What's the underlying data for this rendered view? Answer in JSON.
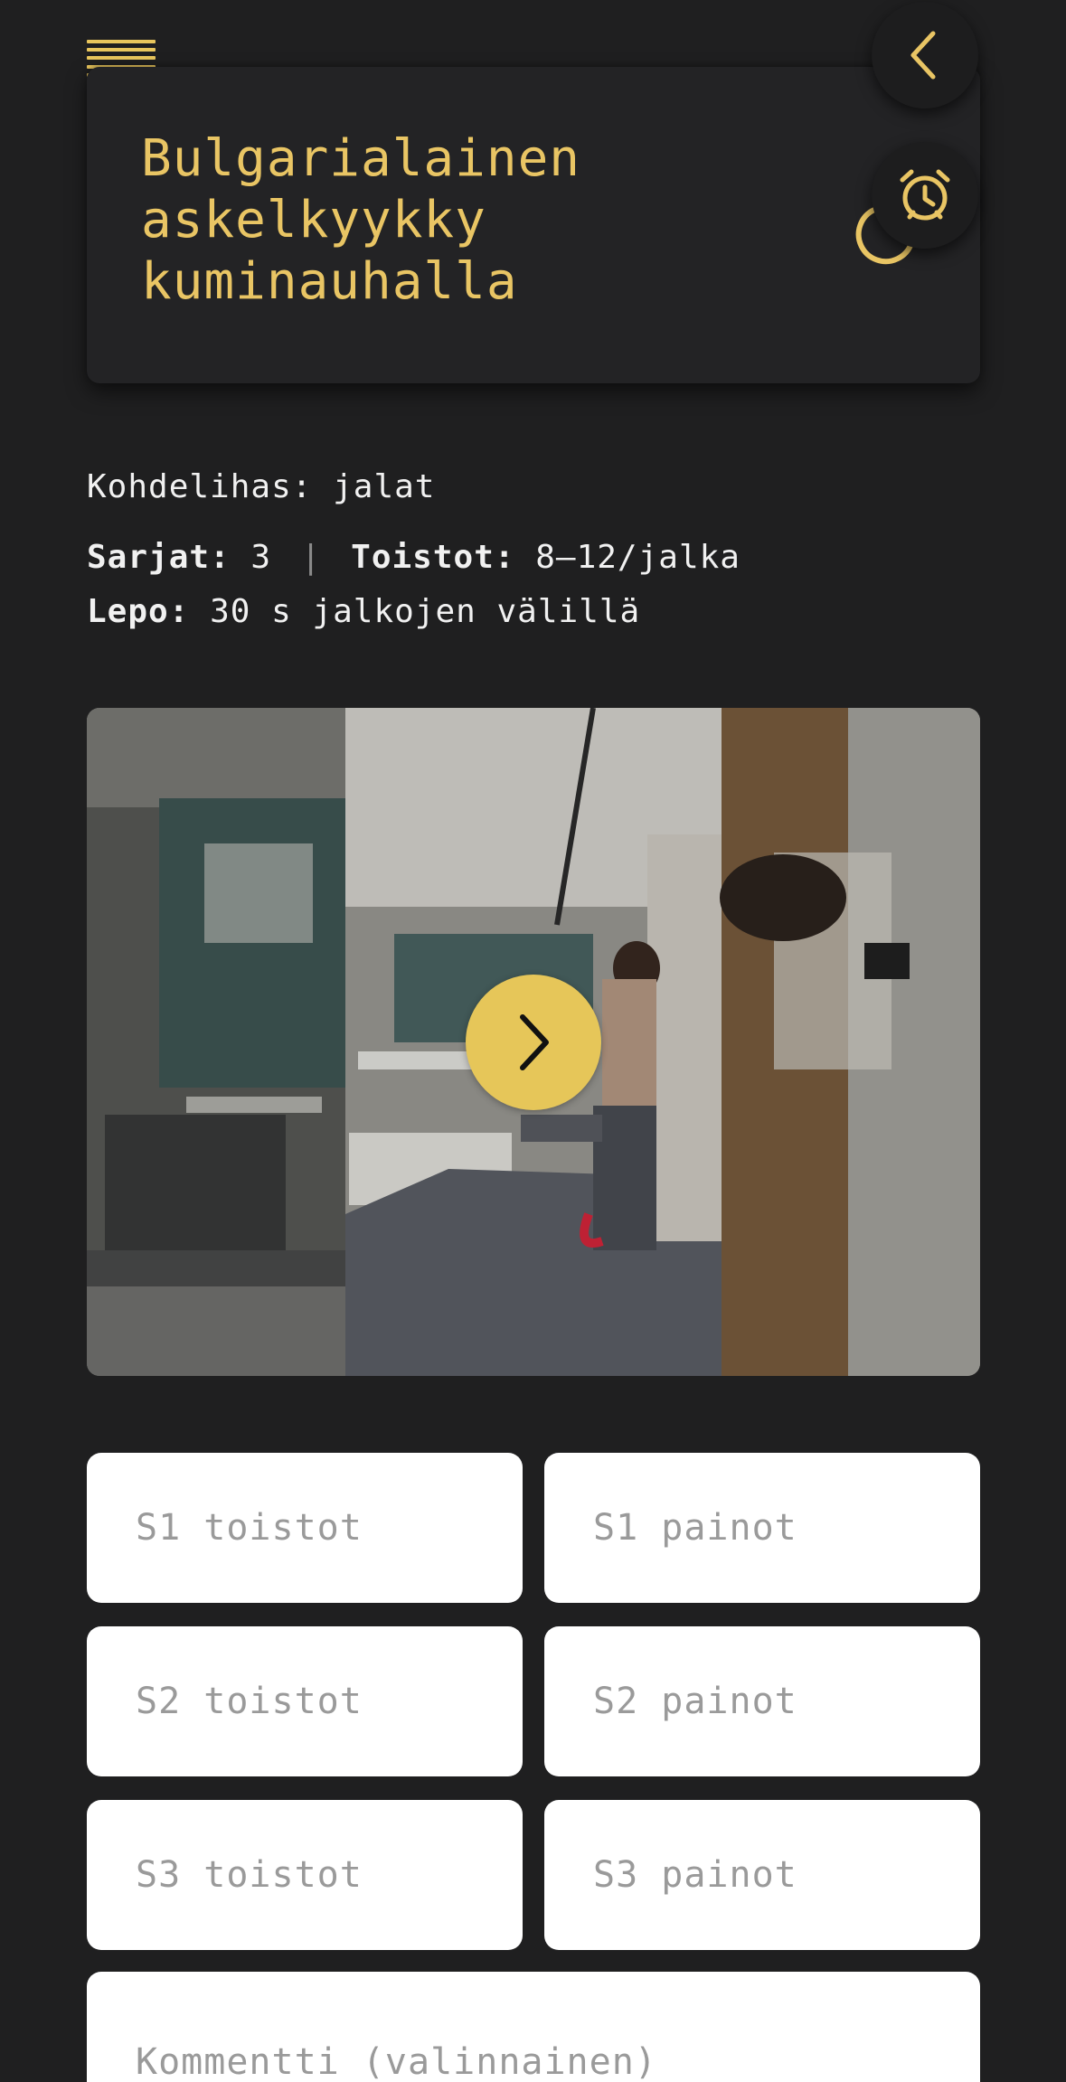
{
  "header": {
    "title_lines": [
      "Bulgarialainen",
      "askelkyykky",
      "kuminauhalla"
    ]
  },
  "icons": {
    "menu": "hamburger-icon",
    "back": "chevron-left-icon",
    "timer": "alarm-clock-icon",
    "next": "chevron-right-icon"
  },
  "exercise": {
    "target_label": "Kohdelihas:",
    "target_value": "jalat",
    "sets_label": "Sarjat:",
    "sets_value": "3",
    "separator": "|",
    "reps_label": "Toistot:",
    "reps_value": "8–12/jalka",
    "rest_label": "Lepo:",
    "rest_value": "30 s jalkojen välillä"
  },
  "form": {
    "s1_reps_placeholder": "S1 toistot",
    "s1_weight_placeholder": "S1 painot",
    "s2_reps_placeholder": "S2 toistot",
    "s2_weight_placeholder": "S2 painot",
    "s3_reps_placeholder": "S3 toistot",
    "s3_weight_placeholder": "S3 painot",
    "comment_placeholder": "Kommentti (valinnainen)"
  },
  "colors": {
    "accent": "#e9c564",
    "background": "#1f1f20",
    "card": "#232325"
  }
}
